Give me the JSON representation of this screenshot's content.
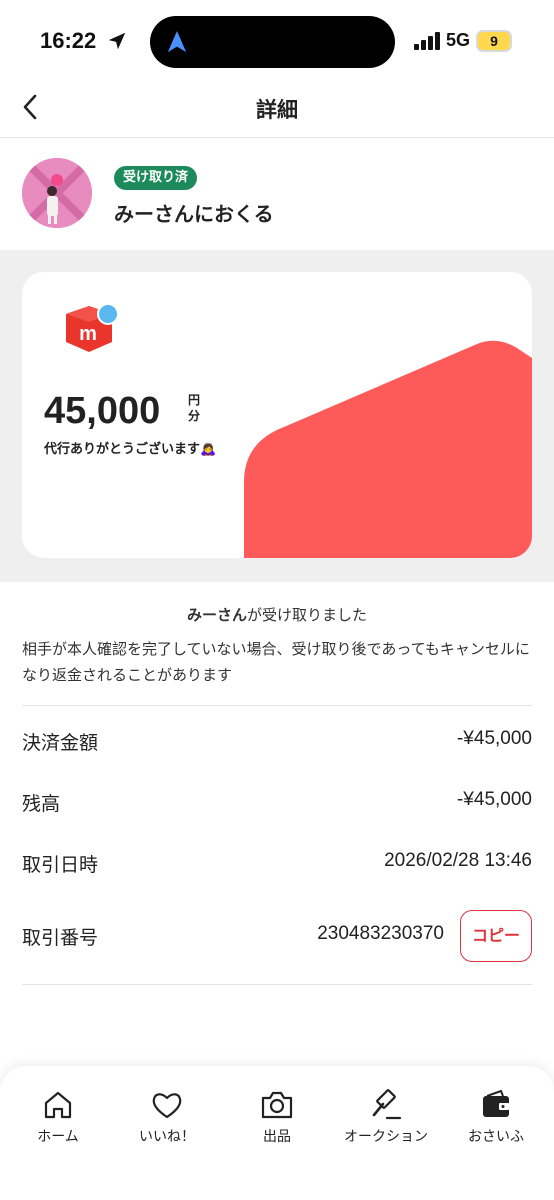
{
  "status_bar": {
    "time": "16:22",
    "network": "5G",
    "battery": "9",
    "icons": [
      "location-arrow-icon",
      "navigation-icon",
      "signal-icon"
    ]
  },
  "header": {
    "title": "詳細",
    "back_icon": "chevron-left-icon"
  },
  "recipient": {
    "badge": "受け取り済",
    "name": "みーさんにおくる",
    "badge_color": "#1d8a5b"
  },
  "card": {
    "amount": "45,000",
    "unit_top": "円",
    "unit_bottom": "分",
    "message": "代行ありがとうございます🙇‍♀️",
    "accent_color": "#ff5a5a",
    "logo": "mercari-logo"
  },
  "receipt": {
    "receiver": "みーさん",
    "received_suffix": "が受け取りました",
    "notice": "相手が本人確認を完了していない場合、受け取り後であってもキャンセルになり返金されることがあります"
  },
  "details": {
    "payment_label": "決済金額",
    "payment_value": "-¥45,000",
    "balance_label": "残高",
    "balance_value": "-¥45,000",
    "datetime_label": "取引日時",
    "datetime_value": "2026/02/28 13:46",
    "txn_label": "取引番号",
    "txn_value": "230483230370",
    "copy_label": "コピー"
  },
  "nav": {
    "items": [
      {
        "label": "ホーム",
        "icon": "home-icon"
      },
      {
        "label": "いいね！",
        "icon": "heart-icon"
      },
      {
        "label": "出品",
        "icon": "camera-icon"
      },
      {
        "label": "オークション",
        "icon": "gavel-icon"
      },
      {
        "label": "おさいふ",
        "icon": "wallet-icon"
      }
    ]
  }
}
